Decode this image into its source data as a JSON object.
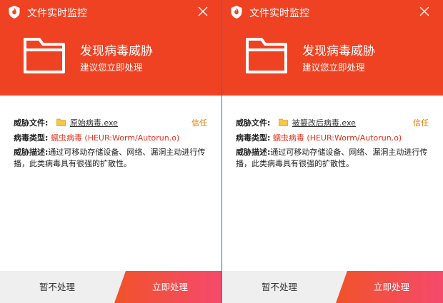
{
  "windows": [
    {
      "title": "文件实时监控",
      "headline": "发现病毒威胁",
      "subheadline": "建议您立即处理",
      "file_label": "威胁文件:",
      "file_name": "原始病毒.exe",
      "trust_label": "信任",
      "virus_type_label": "病毒类型:",
      "virus_name": "蠕虫病毒 (HEUR:Worm/Autorun.o)",
      "desc_label": "威胁描述:",
      "desc_text": "通过可移动存储设备、网络、漏洞主动进行传播，此类病毒具有很强的扩散性。",
      "later_button": "暂不处理",
      "handle_button": "立即处理"
    },
    {
      "title": "文件实时监控",
      "headline": "发现病毒威胁",
      "subheadline": "建议您立即处理",
      "file_label": "威胁文件:",
      "file_name": "被篡改后病毒.exe",
      "trust_label": "信任",
      "virus_type_label": "病毒类型:",
      "virus_name": "蠕虫病毒 (HEUR:Worm/Autorun.o)",
      "desc_label": "威胁描述:",
      "desc_text": "通过可移动存储设备、网络、漏洞主动进行传播，此类病毒具有很强的扩散性。",
      "later_button": "暂不处理",
      "handle_button": "立即处理"
    }
  ],
  "colors": {
    "header": "#ef4223",
    "trust": "#e07b00",
    "virus": "#e3311d",
    "button_start": "#f0532a",
    "button_end": "#f54a6c"
  },
  "icons": {
    "shield": "shield-icon",
    "close": "close-icon",
    "folder": "folder-icon",
    "file": "file-folder-icon"
  }
}
